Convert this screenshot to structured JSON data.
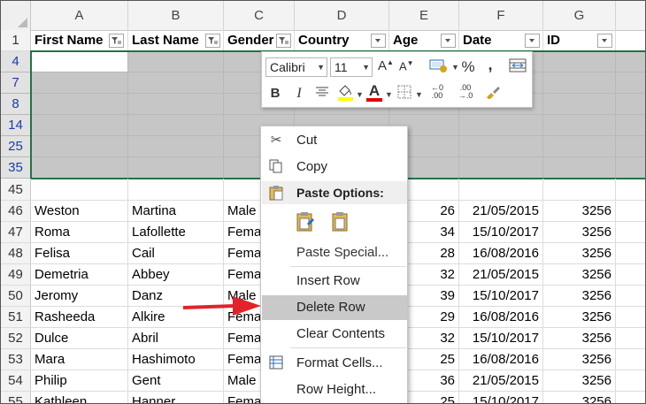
{
  "columns": [
    "A",
    "B",
    "C",
    "D",
    "E",
    "F",
    "G"
  ],
  "header_row": {
    "num": "1",
    "cells": [
      "First Name",
      "Last Name",
      "Gender",
      "Country",
      "Age",
      "Date",
      "ID"
    ]
  },
  "selected_rows": [
    "4",
    "7",
    "8",
    "14",
    "25",
    "35"
  ],
  "row45": "45",
  "rows": [
    {
      "num": "46",
      "first": "Weston",
      "last": "Martina",
      "gender": "Male",
      "age": "26",
      "date": "21/05/2015",
      "id": "3256"
    },
    {
      "num": "47",
      "first": "Roma",
      "last": "Lafollette",
      "gender": "Fema",
      "age": "34",
      "date": "15/10/2017",
      "id": "3256"
    },
    {
      "num": "48",
      "first": "Felisa",
      "last": "Cail",
      "gender": "Fema",
      "age": "28",
      "date": "16/08/2016",
      "id": "3256"
    },
    {
      "num": "49",
      "first": "Demetria",
      "last": "Abbey",
      "gender": "Fema",
      "age": "32",
      "date": "21/05/2015",
      "id": "3256"
    },
    {
      "num": "50",
      "first": "Jeromy",
      "last": "Danz",
      "gender": "Male",
      "age": "39",
      "date": "15/10/2017",
      "id": "3256"
    },
    {
      "num": "51",
      "first": "Rasheeda",
      "last": "Alkire",
      "gender": "Fema",
      "age": "29",
      "date": "16/08/2016",
      "id": "3256"
    },
    {
      "num": "52",
      "first": "Dulce",
      "last": "Abril",
      "gender": "Fema",
      "age": "32",
      "date": "15/10/2017",
      "id": "3256"
    },
    {
      "num": "53",
      "first": "Mara",
      "last": "Hashimoto",
      "gender": "Fema",
      "age": "25",
      "date": "16/08/2016",
      "id": "3256"
    },
    {
      "num": "54",
      "first": "Philip",
      "last": "Gent",
      "gender": "Male",
      "age": "36",
      "date": "21/05/2015",
      "id": "3256"
    },
    {
      "num": "55",
      "first": "Kathleen",
      "last": "Hanner",
      "gender": "Fema",
      "age": "25",
      "date": "15/10/2017",
      "id": "3256"
    }
  ],
  "mini_toolbar": {
    "font": "Calibri",
    "size": "11",
    "bold": "B",
    "italic": "I",
    "percent": "%",
    "comma": ",",
    "increase_font": "A",
    "decrease_font": "A",
    "inc_decimal_top": "←0",
    "inc_decimal_bottom": ".00",
    "dec_decimal_top": ".00",
    "dec_decimal_bottom": "→.0",
    "font_color": "A",
    "fill_color": "#ffff00",
    "font_color_bar": "#e00000"
  },
  "context_menu": {
    "cut": "Cut",
    "copy": "Copy",
    "paste_options": "Paste Options:",
    "paste_special": "Paste Special...",
    "insert_row": "Insert Row",
    "delete_row": "Delete Row",
    "clear_contents": "Clear Contents",
    "format_cells": "Format Cells...",
    "row_height": "Row Height..."
  },
  "colors": {
    "selection_border": "#217346",
    "selected_fill": "#c6c6c6",
    "row_number_selected": "#1a3ea6",
    "arrow": "#e0242a",
    "highlight": "#c9c9c9"
  }
}
